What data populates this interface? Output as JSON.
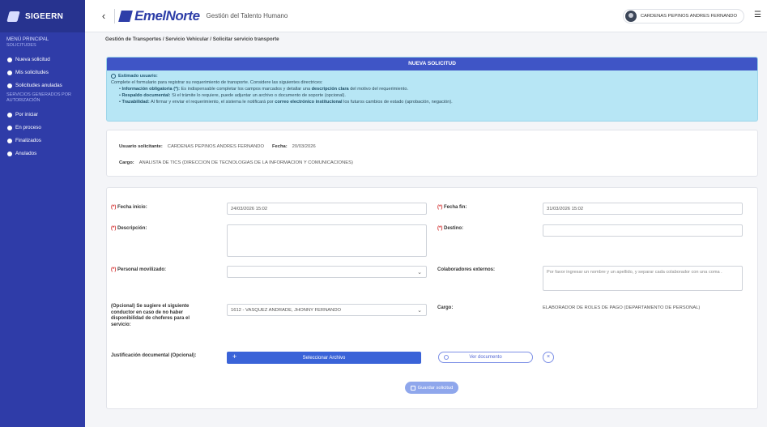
{
  "sidebar": {
    "brand": "SIGEERN",
    "menu_title": "MENÚ PRINCIPAL",
    "section1": "SOLICITUDES",
    "items1": [
      "Nueva solicitud",
      "Mis solicitudes",
      "Solicitudes anuladas"
    ],
    "section2": "SERVICIOS GENERADOS POR AUTORIZACIÓN",
    "items2": [
      "Por iniciar",
      "En proceso",
      "Finalizados",
      "Anulados"
    ]
  },
  "header": {
    "logo": "EmelNorte",
    "title": "Gestión del Talento Humano",
    "user": "CARDENAS PEPINOS ANDRES FERNANDO"
  },
  "breadcrumb": "Gestión de Transportes / Servicio Vehicular / Solicitar servicio transporte",
  "info": {
    "heading": "NUEVA SOLICITUD",
    "greet": "Estimado usuario:",
    "intro": "Complete el formulario para registrar su requerimiento de transporte. Considere las siguientes directrices:",
    "b1_title": "Información obligatoria (*):",
    "b1_text_a": " Es indispensable completar los campos marcados y detallar una ",
    "b1_bold": "descripción clara",
    "b1_text_b": " del motivo del requerimiento.",
    "b2_title": "Respaldo documental:",
    "b2_text": " Si el trámite lo requiere, puede adjuntar un archivo o documento de soporte (opcional).",
    "b3_title": "Trazabilidad:",
    "b3_text_a": " Al firmar y enviar el requerimiento, el sistema le notificará por ",
    "b3_bold": "correo electrónico institucional",
    "b3_text_b": " los futuros cambios de estado (aprobación, negación)."
  },
  "user_card": {
    "user_label": "Usuario solicitante:",
    "user_value": "CARDENAS PEPINOS ANDRES FERNANDO",
    "date_label": "Fecha:",
    "date_value": "20/03/2026",
    "role_label": "Cargo:",
    "role_value": "ANALISTA DE TICS (DIRECCION DE TECNOLOGIAS DE LA INFORMACION Y COMUNICACIONES)"
  },
  "form": {
    "req_mark": "(*)",
    "start_label": "Fecha inicio:",
    "start_value": "24/03/2026 15:02",
    "end_label": "Fecha fin:",
    "end_value": "31/03/2026 15:02",
    "desc_label": "Descripción:",
    "dest_label": "Destino:",
    "staff_label": "Personal movilizado:",
    "ext_label": "Colaboradores externos:",
    "ext_placeholder": "Por favor ingresar un nombre y un apellido, y separar cada colaborador con una coma .",
    "driver_label": "(Opcional) Se sugiere el siguiente conductor en caso de no haber disponibilidad de choferes para el servicio:",
    "driver_value": "1612 - VASQUEZ ANDRADE, JHONNY FERNANDO",
    "cargo_label": "Cargo:",
    "cargo_value": "ELABORADOR DE ROLES DE PAGO (DEPARTAMENTO DE PERSONAL)",
    "doc_label": "Justificación documental (Opcional):",
    "file_btn": "Seleccionar Archivo",
    "view_btn": "Ver documento",
    "save_btn": "Guardar solicitud"
  }
}
